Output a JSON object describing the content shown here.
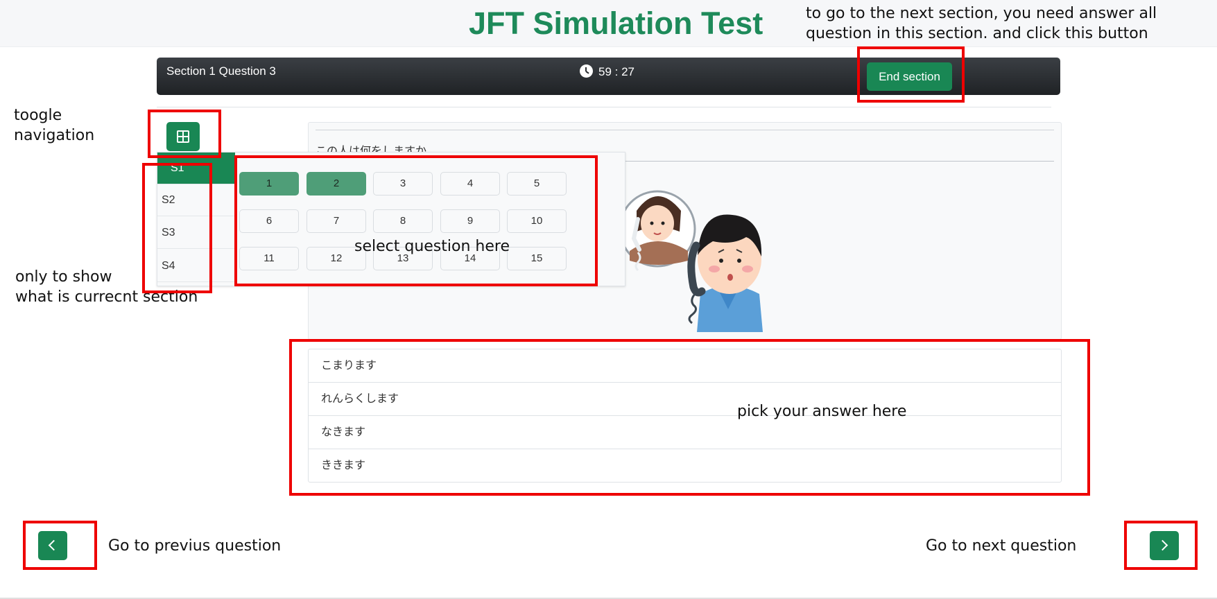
{
  "header": {
    "title": "JFT Simulation Test"
  },
  "exam_bar": {
    "title": "Section 1 Question 3",
    "timer": "59 : 27",
    "end_button": "End section"
  },
  "question": {
    "text": "この人は何をしますか"
  },
  "sections": [
    "S1",
    "S2",
    "S3",
    "S4"
  ],
  "question_numbers": [
    "1",
    "2",
    "3",
    "4",
    "5",
    "6",
    "7",
    "8",
    "9",
    "10",
    "11",
    "12",
    "13",
    "14",
    "15"
  ],
  "answers": [
    "こまります",
    "れんらくします",
    "なきます",
    "ききます"
  ],
  "annotations": {
    "end_section": [
      "to go to the next section,  you need answer all",
      "question in this section. and click this button"
    ],
    "toggle": [
      "toogle",
      "navigation"
    ],
    "current_section": [
      "only to show",
      "what is currecnt section"
    ],
    "select_question": "select question here",
    "pick_answer": "pick your answer here",
    "prev": "Go to previus question",
    "next": "Go to next question"
  },
  "icons": [
    "clock-icon",
    "grid-icon",
    "chevron-left-icon",
    "chevron-right-icon"
  ],
  "colors": {
    "brand_green": "#1e8a5a",
    "button_green": "#198754",
    "answered": "#4f9e78",
    "annotation_red": "#ee0000",
    "bar_dark": "#2b2e32"
  }
}
